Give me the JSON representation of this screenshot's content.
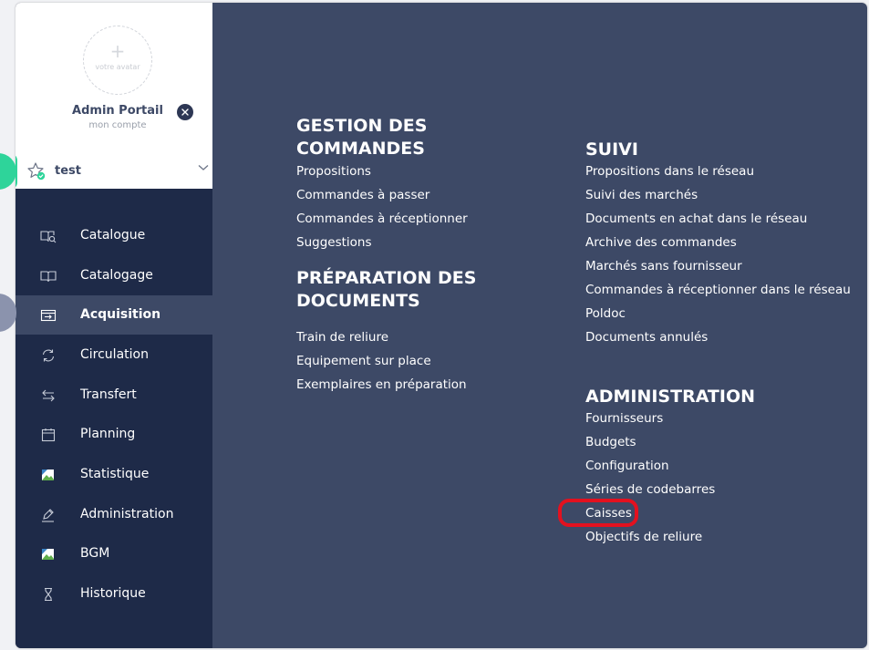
{
  "profile": {
    "avatar_plus": "+",
    "avatar_text": "votre avatar",
    "name": "Admin Portail",
    "subtitle": "mon compte",
    "context_label": "test"
  },
  "nav": {
    "items": [
      {
        "label": "Catalogue",
        "icon": "book-search-icon"
      },
      {
        "label": "Catalogage",
        "icon": "open-book-icon"
      },
      {
        "label": "Acquisition",
        "icon": "inbox-arrow-icon",
        "active": true
      },
      {
        "label": "Circulation",
        "icon": "refresh-icon"
      },
      {
        "label": "Transfert",
        "icon": "swap-arrows-icon"
      },
      {
        "label": "Planning",
        "icon": "calendar-icon"
      },
      {
        "label": "Statistique",
        "icon": "broken-image-icon"
      },
      {
        "label": "Administration",
        "icon": "pen-icon"
      },
      {
        "label": "BGM",
        "icon": "broken-image-icon"
      },
      {
        "label": "Historique",
        "icon": "hourglass-icon"
      }
    ]
  },
  "menu": {
    "gestion": {
      "title_line1": "GESTION DES",
      "title_line2": "COMMANDES",
      "links": [
        "Propositions",
        "Commandes à passer",
        "Commandes à réceptionner",
        "Suggestions"
      ]
    },
    "preparation": {
      "title_line1": "PRÉPARATION DES",
      "title_line2": "DOCUMENTS",
      "links": [
        "Train de reliure",
        "Equipement sur place",
        "Exemplaires en préparation"
      ]
    },
    "suivi": {
      "title": "SUIVI",
      "links": [
        "Propositions dans le réseau",
        "Suivi des marchés",
        "Documents en achat dans le réseau",
        "Archive des commandes",
        "Marchés sans fournisseur",
        "Commandes à réceptionner dans le réseau",
        "Poldoc",
        "Documents annulés"
      ]
    },
    "administration": {
      "title": "ADMINISTRATION",
      "links": [
        "Fournisseurs",
        "Budgets",
        "Configuration",
        "Séries de codebarres",
        "Caisses",
        "Objectifs de reliure"
      ]
    }
  },
  "colors": {
    "sidebar_bg": "#1e2a48",
    "main_bg": "#3d4966",
    "accent_green": "#2ed49a",
    "highlight_red": "#e3111f"
  }
}
